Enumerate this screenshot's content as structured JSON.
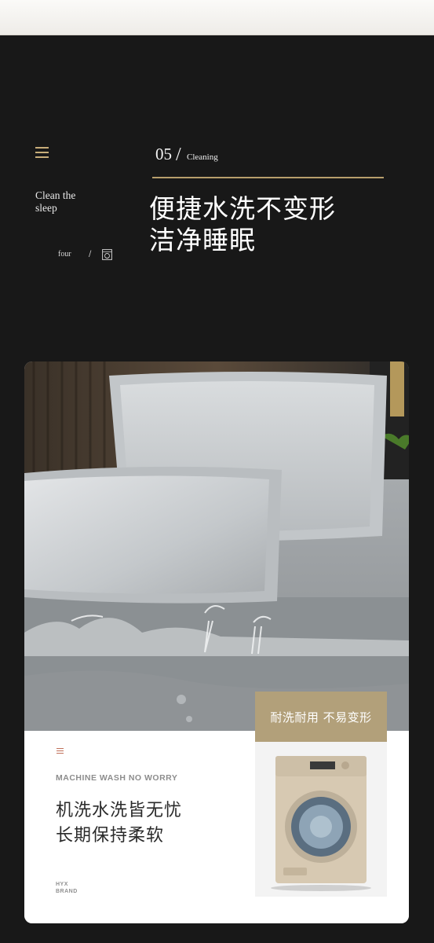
{
  "header": {
    "tagline_line1": "Clean the",
    "tagline_line2": "sleep",
    "page_word": "four",
    "slash": "/",
    "section_number": "05",
    "section_slash": "/",
    "section_label": "Cleaning",
    "headline_line1": "便捷水洗不变形",
    "headline_line2": "洁净睡眠"
  },
  "feature": {
    "subtitle_en": "MACHINE WASH NO WORRY",
    "subtitle_cn_line1": "机洗水洗皆无忧",
    "subtitle_cn_line2": "长期保持柔软",
    "brand_line1": "HYX",
    "brand_line2": "BRAND",
    "badge_text": "耐洗耐用 不易变形"
  },
  "colors": {
    "background": "#181818",
    "accent_gold": "#b79e6c",
    "badge": "#b2a07a",
    "fabric": "#c9ccce"
  },
  "icons": [
    "menu-icon",
    "washing-machine-icon"
  ]
}
